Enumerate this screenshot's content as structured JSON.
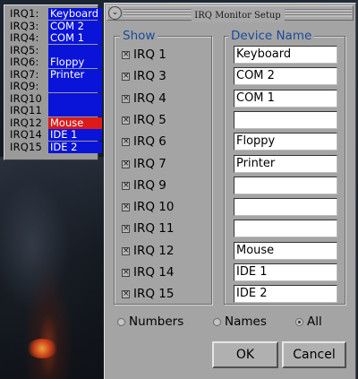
{
  "monitor": {
    "rows": [
      {
        "irq": "IRQ1:",
        "device": "Keyboard"
      },
      {
        "irq": "IRQ3:",
        "device": "COM 2"
      },
      {
        "irq": "IRQ4:",
        "device": "COM 1"
      },
      {
        "irq": "IRQ5:",
        "device": ""
      },
      {
        "irq": "IRQ6:",
        "device": "Floppy"
      },
      {
        "irq": "IRQ7:",
        "device": "Printer"
      },
      {
        "irq": "IRQ9:",
        "device": ""
      },
      {
        "irq": "IRQ10",
        "device": ""
      },
      {
        "irq": "IRQ11",
        "device": ""
      },
      {
        "irq": "IRQ12",
        "device": "Mouse"
      },
      {
        "irq": "IRQ14",
        "device": "IDE 1"
      },
      {
        "irq": "IRQ15",
        "device": "IDE 2"
      }
    ],
    "colors": {
      "bar": "#0a14d8",
      "active": "#dc1a1a"
    }
  },
  "dialog": {
    "title": "IRQ Monitor Setup",
    "menu_icon": "chevron-down-icon",
    "show_group_title": "Show",
    "device_group_title": "Device Name",
    "irqs": [
      {
        "label": "IRQ 1",
        "checked": true,
        "device": "Keyboard"
      },
      {
        "label": "IRQ 3",
        "checked": true,
        "device": "COM 2"
      },
      {
        "label": "IRQ 4",
        "checked": true,
        "device": "COM 1"
      },
      {
        "label": "IRQ 5",
        "checked": true,
        "device": ""
      },
      {
        "label": "IRQ 6",
        "checked": true,
        "device": "Floppy"
      },
      {
        "label": "IRQ 7",
        "checked": true,
        "device": "Printer"
      },
      {
        "label": "IRQ 9",
        "checked": true,
        "device": ""
      },
      {
        "label": "IRQ 10",
        "checked": true,
        "device": ""
      },
      {
        "label": "IRQ 11",
        "checked": true,
        "device": ""
      },
      {
        "label": "IRQ 12",
        "checked": true,
        "device": "Mouse"
      },
      {
        "label": "IRQ 14",
        "checked": true,
        "device": "IDE 1"
      },
      {
        "label": "IRQ 15",
        "checked": true,
        "device": "IDE 2"
      }
    ],
    "display_mode": {
      "options": [
        "Numbers",
        "Names",
        "All"
      ],
      "selected": "All"
    },
    "buttons": {
      "ok": "OK",
      "cancel": "Cancel"
    }
  }
}
